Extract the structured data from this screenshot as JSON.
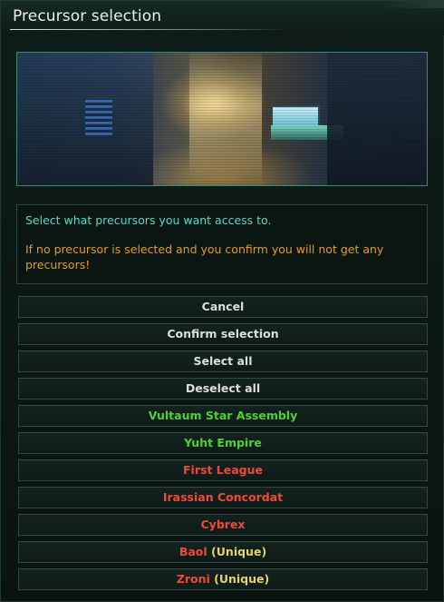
{
  "window": {
    "title": "Precursor selection"
  },
  "message": {
    "line1": "Select what precursors you want access to.",
    "line2": "If no precursor is selected and you confirm you will not get any precursors!"
  },
  "actions": {
    "cancel": "Cancel",
    "confirm": "Confirm selection",
    "select_all": "Select all",
    "deselect_all": "Deselect all"
  },
  "precursors": [
    {
      "name": "Vultaum Star Assembly",
      "status": "selected"
    },
    {
      "name": "Yuht Empire",
      "status": "selected"
    },
    {
      "name": "First League",
      "status": "unselected"
    },
    {
      "name": "Irassian Concordat",
      "status": "unselected"
    },
    {
      "name": "Cybrex",
      "status": "unselected"
    },
    {
      "name": "Baol",
      "status": "unselected",
      "tag": "Unique"
    },
    {
      "name": "Zroni",
      "status": "unselected",
      "tag": "Unique"
    }
  ],
  "colors": {
    "selected": "#4fd12f",
    "unselected": "#ef4a37",
    "unique_tag": "#e2d36b",
    "info_text": "#59d9c2",
    "warning_text": "#e59c1e"
  }
}
